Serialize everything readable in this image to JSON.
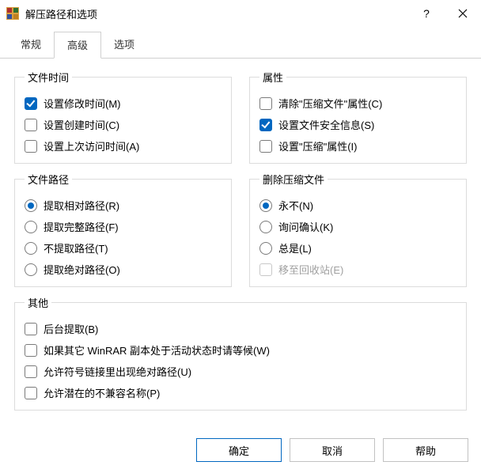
{
  "window": {
    "title": "解压路径和选项"
  },
  "tabs": {
    "general": "常规",
    "advanced": "高级",
    "options": "选项",
    "active": "advanced"
  },
  "groups": {
    "file_time": {
      "legend": "文件时间",
      "set_modify": "设置修改时间(M)",
      "set_create": "设置创建时间(C)",
      "set_access": "设置上次访问时间(A)"
    },
    "file_path": {
      "legend": "文件路径",
      "extract_relative": "提取相对路径(R)",
      "extract_full": "提取完整路径(F)",
      "no_extract": "不提取路径(T)",
      "extract_absolute": "提取绝对路径(O)"
    },
    "attributes": {
      "legend": "属性",
      "clear_archive": "清除\"压缩文件\"属性(C)",
      "set_security": "设置文件安全信息(S)",
      "set_compress": "设置\"压缩\"属性(I)"
    },
    "delete_archive": {
      "legend": "删除压缩文件",
      "never": "永不(N)",
      "ask": "询问确认(K)",
      "always": "总是(L)",
      "recycle": "移至回收站(E)"
    },
    "other": {
      "legend": "其他",
      "background": "后台提取(B)",
      "wait_other": "如果其它 WinRAR 副本处于活动状态时请等候(W)",
      "allow_symlinks": "允许符号链接里出现绝对路径(U)",
      "allow_incompatible": "允许潜在的不兼容名称(P)"
    }
  },
  "buttons": {
    "ok": "确定",
    "cancel": "取消",
    "help": "帮助"
  }
}
